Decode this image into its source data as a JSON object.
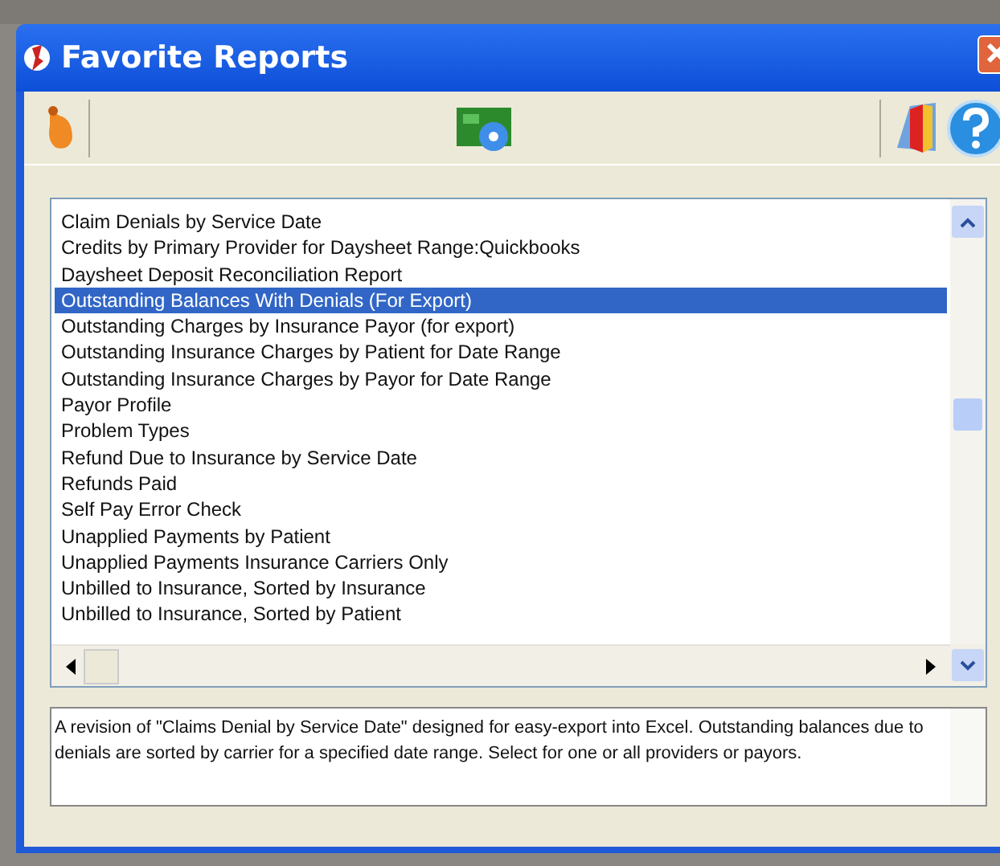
{
  "window": {
    "title": "Favorite Reports"
  },
  "reports": [
    {
      "label": "Claim Denials by Service Date",
      "selected": false
    },
    {
      "label": "Credits by Primary Provider for Daysheet Range:Quickbooks",
      "selected": false
    },
    {
      "label": "Daysheet Deposit Reconciliation Report",
      "selected": false
    },
    {
      "label": "Outstanding Balances With Denials (For Export)",
      "selected": true
    },
    {
      "label": "Outstanding Charges by Insurance Payor (for export)",
      "selected": false
    },
    {
      "label": "Outstanding Insurance Charges by Patient for Date Range",
      "selected": false
    },
    {
      "label": "Outstanding Insurance Charges by Payor for Date Range",
      "selected": false
    },
    {
      "label": "Payor Profile",
      "selected": false
    },
    {
      "label": "Problem Types",
      "selected": false
    },
    {
      "label": "Refund Due to Insurance by Service Date",
      "selected": false
    },
    {
      "label": "Refunds Paid",
      "selected": false
    },
    {
      "label": "Self Pay Error Check",
      "selected": false
    },
    {
      "label": "Unapplied Payments by Patient",
      "selected": false
    },
    {
      "label": "Unapplied Payments Insurance Carriers Only",
      "selected": false
    },
    {
      "label": "Unbilled to Insurance, Sorted by Insurance",
      "selected": false
    },
    {
      "label": "Unbilled to Insurance, Sorted by Patient",
      "selected": false
    }
  ],
  "description": "A revision of \"Claims Denial by Service Date\" designed for easy-export into Excel. Outstanding balances due to denials are sorted by carrier for a specified date range. Select for one or all providers or payors."
}
